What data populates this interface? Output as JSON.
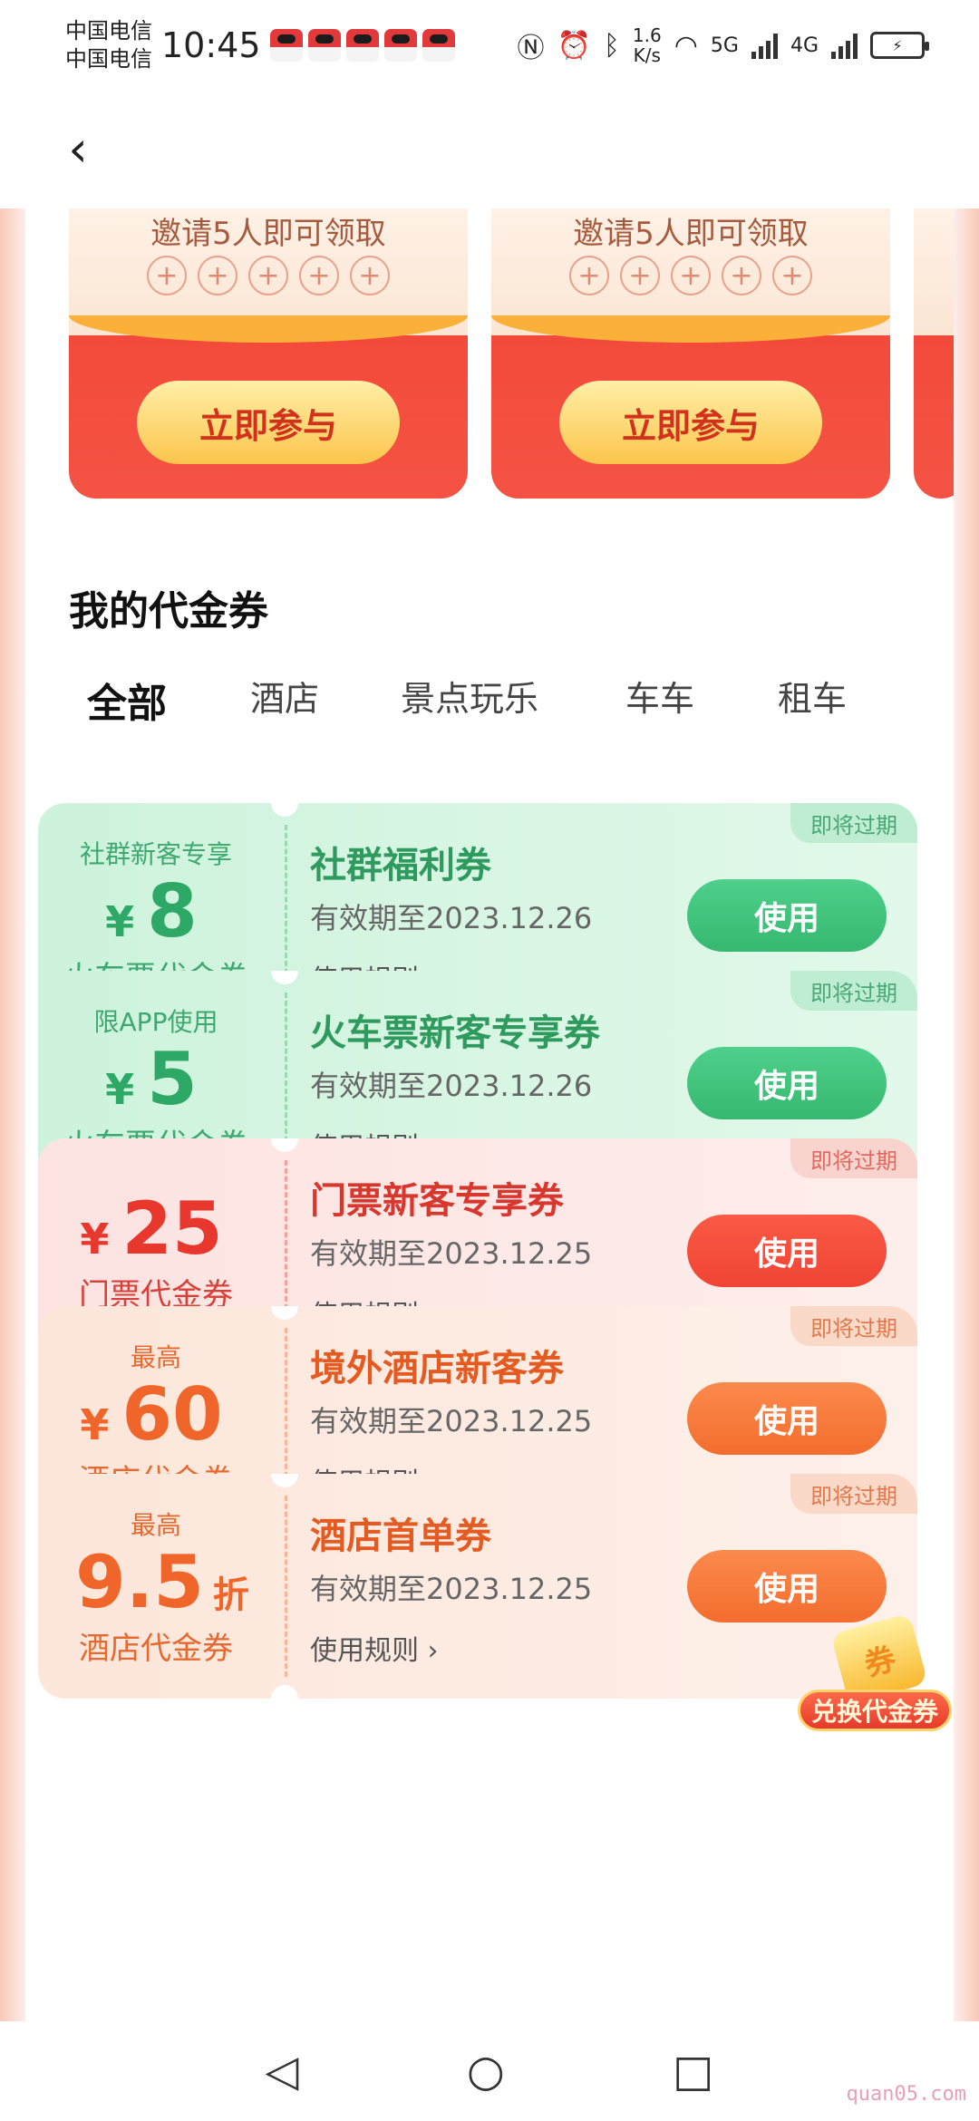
{
  "status_bar": {
    "carrier1": "中国电信",
    "carrier2": "中国电信",
    "time": "10:45",
    "speed_value": "1.6",
    "speed_unit": "K/s",
    "net1": "5G",
    "net2": "4G"
  },
  "header": {
    "back_icon": "chevron-left-icon"
  },
  "promos": [
    {
      "invite_text": "邀请5人即可领取",
      "join_label": "立即参与"
    },
    {
      "invite_text": "邀请5人即可领取",
      "join_label": "立即参与"
    }
  ],
  "section_title": "我的代金券",
  "tabs": [
    "全部",
    "酒店",
    "景点玩乐",
    "车车",
    "租车"
  ],
  "coupons": [
    {
      "top_note": "社群新客专享",
      "currency": "¥",
      "amount": "8",
      "unit": "",
      "kind": "火车票代金券",
      "title": "社群福利券",
      "expiry": "有效期至2023.12.26",
      "rule": "使用规则 ›",
      "use_label": "使用",
      "tag": "即将过期",
      "theme": "green"
    },
    {
      "top_note": "限APP使用",
      "currency": "¥",
      "amount": "5",
      "unit": "",
      "kind": "火车票代金券",
      "title": "火车票新客专享券",
      "expiry": "有效期至2023.12.26",
      "rule": "使用规则 ›",
      "use_label": "使用",
      "tag": "即将过期",
      "theme": "green"
    },
    {
      "top_note": "",
      "currency": "¥",
      "amount": "25",
      "unit": "",
      "kind": "门票代金券",
      "title": "门票新客专享券",
      "expiry": "有效期至2023.12.25",
      "rule": "使用规则 ›",
      "use_label": "使用",
      "tag": "即将过期",
      "theme": "red"
    },
    {
      "top_note": "最高",
      "currency": "¥",
      "amount": "60",
      "unit": "",
      "kind": "酒店代金券",
      "title": "境外酒店新客券",
      "expiry": "有效期至2023.12.25",
      "rule": "使用规则 ›",
      "use_label": "使用",
      "tag": "即将过期",
      "theme": "orange"
    },
    {
      "top_note": "最高",
      "currency": "",
      "amount": "9.5",
      "unit": "折",
      "kind": "酒店代金券",
      "title": "酒店首单券",
      "expiry": "有效期至2023.12.25",
      "rule": "使用规则 ›",
      "use_label": "使用",
      "tag": "即将过期",
      "theme": "orange"
    }
  ],
  "floating_badge": {
    "coin_text": "券",
    "label": "兑换代金券"
  },
  "nav": {
    "back": "◁",
    "home": "○",
    "recent": "□"
  },
  "watermark": "quan05.com",
  "colors": {
    "green_accent": "#36b871",
    "red_accent": "#f04434",
    "orange_accent": "#f36d2e"
  }
}
